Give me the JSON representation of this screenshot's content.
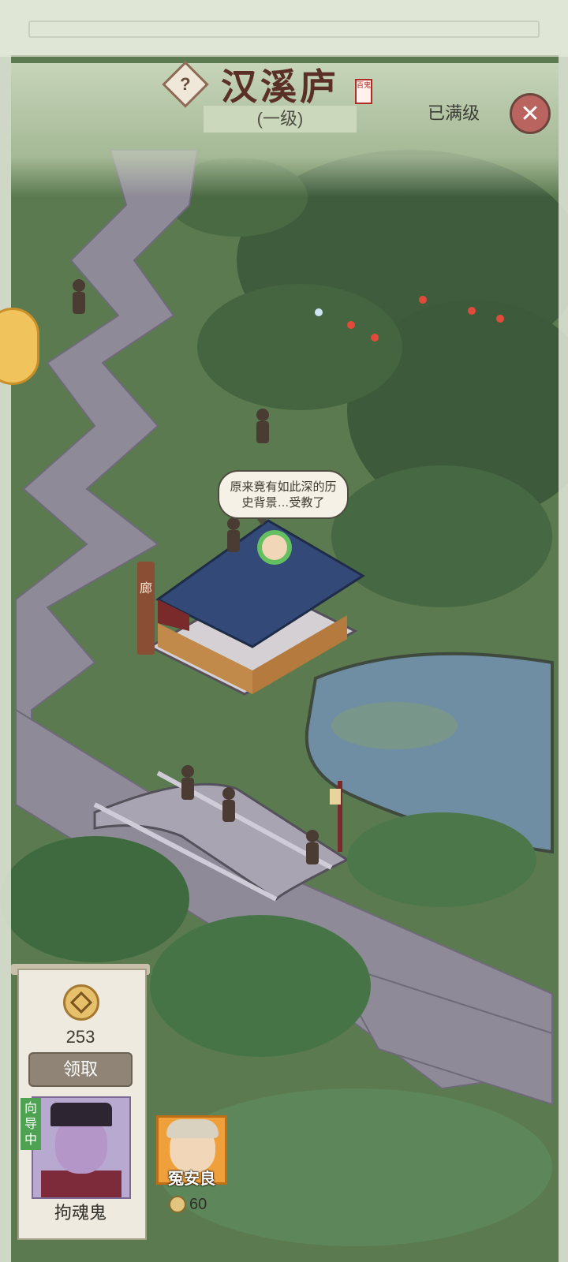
{
  "header": {
    "title": "汉溪庐",
    "level": "(一级)",
    "seal_text": "百鬼",
    "max_status": "已满级",
    "help_icon": "?",
    "close_icon": "✕"
  },
  "scene": {
    "speech_bubble": "原来竟有如此深的历史背景…受教了",
    "building_sign": "廊"
  },
  "reward_panel": {
    "amount": "253",
    "claim_label": "领取",
    "guide_tag": "向导中",
    "character_name": "拘魂鬼"
  },
  "worker": {
    "name": "冤安良",
    "cost": "60"
  },
  "colors": {
    "grass": "#5b7a50",
    "path": "#8f8a98",
    "water": "#6f8ea3",
    "accent_orange": "#f0a03a",
    "close_red": "#b9645f"
  }
}
